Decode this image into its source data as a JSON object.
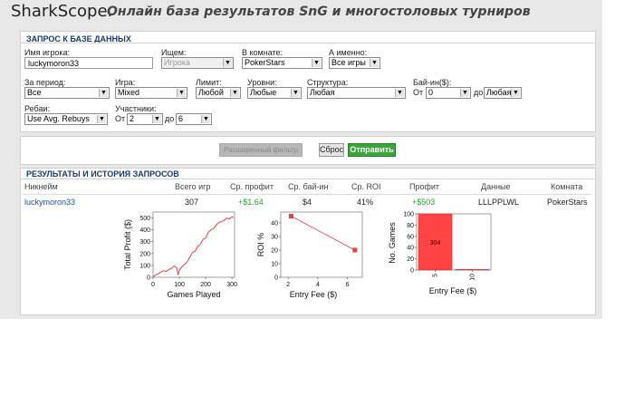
{
  "header": {
    "brand": "SharkScope.",
    "subtitle": "Онлайн база результатов SnG и многостоловых турниров"
  },
  "query": {
    "section_title": "ЗАПРОС К БАЗЕ ДАННЫХ",
    "player_label": "Имя игрока:",
    "player_value": "luckymoron33",
    "search_label": "Ищем:",
    "search_value": "Игрока",
    "room_label": "В комнате:",
    "room_value": "PokerStars",
    "which_label": "А именно:",
    "which_value": "Все игры",
    "period_label": "За период:",
    "period_value": "Все",
    "game_label": "Игра:",
    "game_value": "Mixed",
    "limit_label": "Лимит:",
    "limit_value": "Любой",
    "levels_label": "Уровни:",
    "levels_value": "Любые",
    "structure_label": "Структура:",
    "structure_value": "Любая",
    "buyin_label": "Бай-ин($):",
    "buyin_from_label": "От",
    "buyin_from_value": "0",
    "buyin_to_label": "до",
    "buyin_to_value": "Любая",
    "rebuy_label": "Ребаи:",
    "rebuy_value": "Use Avg. Rebuys",
    "participants_label": "Участники:",
    "participants_from_label": "От",
    "participants_from_value": "2",
    "participants_to_label": "до",
    "participants_to_value": "6"
  },
  "buttons": {
    "advanced": "Расширенный фильтр",
    "reset": "Сброс",
    "submit": "Отправить"
  },
  "results": {
    "section_title": "РЕЗУЛЬТАТЫ И ИСТОРИЯ ЗАПРОСОВ",
    "columns": [
      "Никнейм",
      "Всего игр",
      "Ср. профит",
      "Ср. бай-ин",
      "Ср. ROI",
      "Профит",
      "Данные",
      "Комната"
    ],
    "row": {
      "nickname": "luckymoron33",
      "games": "307",
      "avg_profit": "+$1.64",
      "avg_buyin": "$4",
      "avg_roi": "41%",
      "profit": "+$503",
      "data": "LLLPPLWL",
      "room": "PokerStars"
    }
  },
  "colors": {
    "accent_green": "#2e9e2e",
    "submit_bg": "#3aa53a",
    "link_blue": "#1a4fa0",
    "title_blue": "#1a3a6b",
    "chart_red": "#e84040"
  },
  "chart_data": [
    {
      "type": "line",
      "xlabel": "Games Played",
      "ylabel": "Total Profit ($)",
      "xlim": [
        0,
        310
      ],
      "ylim": [
        0,
        550
      ],
      "xticks": [
        0,
        100,
        200,
        300
      ],
      "yticks": [
        0,
        100,
        200,
        300,
        400,
        500
      ],
      "x": [
        0,
        10,
        20,
        30,
        40,
        50,
        60,
        70,
        80,
        90,
        95,
        100,
        110,
        120,
        130,
        140,
        150,
        160,
        170,
        180,
        190,
        200,
        210,
        220,
        230,
        240,
        250,
        260,
        270,
        280,
        290,
        300,
        307
      ],
      "y": [
        5,
        20,
        30,
        45,
        55,
        50,
        65,
        75,
        95,
        80,
        20,
        60,
        90,
        110,
        130,
        170,
        210,
        220,
        260,
        280,
        320,
        330,
        380,
        400,
        410,
        440,
        460,
        470,
        480,
        500,
        490,
        510,
        503
      ]
    },
    {
      "type": "scatter",
      "xlabel": "Entry Fee ($)",
      "ylabel": "ROI %",
      "xlim": [
        1.5,
        7
      ],
      "ylim": [
        0,
        48
      ],
      "xticks": [
        2,
        4,
        6
      ],
      "yticks": [
        0,
        10,
        20,
        30,
        40
      ],
      "x": [
        2.2,
        6.5
      ],
      "y": [
        45,
        20
      ]
    },
    {
      "type": "bar",
      "xlabel": "Entry Fee ($)",
      "ylabel": "No. Games",
      "categories": [
        "5",
        "10"
      ],
      "values": [
        304,
        3
      ],
      "data_labels": [
        "304",
        ""
      ],
      "ylim": [
        0,
        304
      ],
      "yticks": [
        "0",
        "20",
        "40",
        "60",
        "80",
        "100"
      ]
    }
  ]
}
